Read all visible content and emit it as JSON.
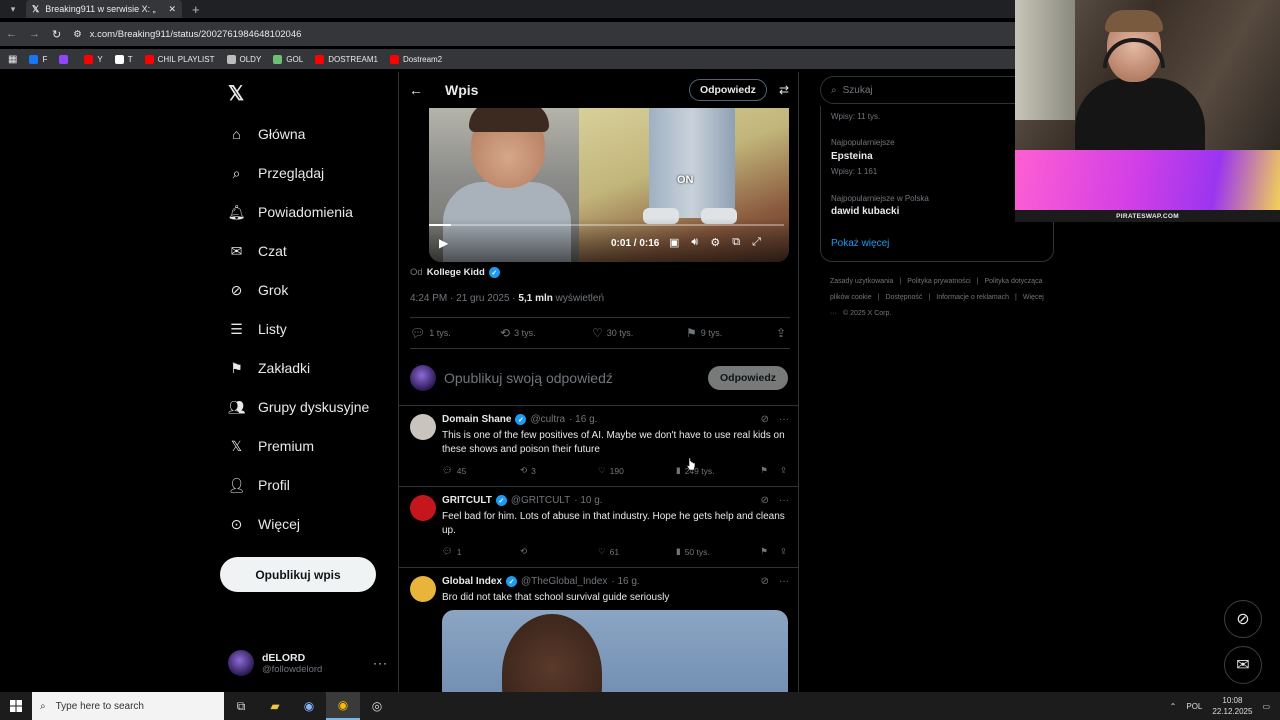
{
  "browser": {
    "tab_title": "Breaking911 w serwisie X: „",
    "url_host": "x.com",
    "url_path": "/Breaking911/status/2002761984648102046",
    "bookmarks": [
      {
        "label": "F",
        "color": "#1877f2"
      },
      {
        "label": "",
        "color": "#9146ff"
      },
      {
        "label": "Y",
        "color": "#ff0000"
      },
      {
        "label": "T",
        "color": "#ffffff"
      },
      {
        "label": "CHIL PLAYLIST",
        "color": "#ff0000"
      },
      {
        "label": "OLDY",
        "color": "#bdbdbd"
      },
      {
        "label": "GOL",
        "color": "#6fbf73"
      },
      {
        "label": "DOSTREAM1",
        "color": "#ff0000"
      },
      {
        "label": "Dostream2",
        "color": "#ff0000"
      }
    ]
  },
  "nav": {
    "items": [
      {
        "label": "Główna",
        "icon": "home-icon"
      },
      {
        "label": "Przeglądaj",
        "icon": "search-icon"
      },
      {
        "label": "Powiadomienia",
        "icon": "bell-icon"
      },
      {
        "label": "Czat",
        "icon": "mail-icon"
      },
      {
        "label": "Grok",
        "icon": "grok-icon"
      },
      {
        "label": "Listy",
        "icon": "list-icon"
      },
      {
        "label": "Zakładki",
        "icon": "bookmark-icon"
      },
      {
        "label": "Grupy dyskusyjne",
        "icon": "people-icon"
      },
      {
        "label": "Premium",
        "icon": "x-icon"
      },
      {
        "label": "Profil",
        "icon": "person-icon"
      },
      {
        "label": "Więcej",
        "icon": "more-circle-icon"
      }
    ],
    "post_button": "Opublikuj wpis",
    "profile": {
      "name": "dELORD",
      "handle": "@followdelord"
    }
  },
  "main": {
    "title": "Wpis",
    "reply_button": "Odpowiedz",
    "video": {
      "time": "0:01 / 0:16",
      "overlay_text": "ON",
      "progress": 0.0625
    },
    "source_prefix": "Od",
    "source_name": "Kollege Kidd",
    "timestamp": "4:24 PM · 21 gru 2025 ·",
    "views_num": "5,1 mln",
    "views_label": "wyświetleń",
    "stats": {
      "replies": "1 tys.",
      "reposts": "3 tys.",
      "likes": "30 tys.",
      "bookmarks": "9 tys."
    },
    "compose": {
      "placeholder": "Opublikuj swoją odpowiedź",
      "button": "Odpowiedz"
    },
    "replies": [
      {
        "name": "Domain Shane",
        "handle": "@cultra",
        "time": "· 16 g.",
        "text": "This is one of the few positives of AI. Maybe we don't have to use real kids on these shows and poison their future",
        "replies": "45",
        "reposts": "3",
        "likes": "190",
        "views": "249 tys.",
        "avatar_color": "#c9c4bd"
      },
      {
        "name": "GRITCULT",
        "handle": "@GRITCULT",
        "time": "· 10 g.",
        "text": "Feel bad for him. Lots of abuse in that industry. Hope he gets help and cleans up.",
        "replies": "1",
        "reposts": "",
        "likes": "61",
        "views": "50 tys.",
        "avatar_color": "#c4161c"
      },
      {
        "name": "Global Index",
        "handle": "@TheGlobal_Index",
        "time": "· 16 g.",
        "text": "Bro did not take that school survival guide seriously",
        "avatar_color": "#e8b53a"
      }
    ]
  },
  "sidebar": {
    "search_placeholder": "Szukaj",
    "trends": [
      {
        "context": "Wpisy: 11 tys."
      },
      {
        "context": "Najpopularniejsze",
        "title": "Epsteina",
        "count": "Wpisy: 1 161"
      },
      {
        "context": "Najpopularniejsze w Polska",
        "title": "dawid kubacki"
      }
    ],
    "show_more": "Pokaż więcej",
    "footer": [
      "Zasady użytkowania",
      "|",
      "Polityka prywatności",
      "|",
      "Polityka dotycząca plików cookie",
      "|",
      "Dostępność",
      "|",
      "Informacje o reklamach",
      "|",
      "Więcej ···",
      "© 2025 X Corp."
    ]
  },
  "overlay": {
    "banner_text": "PIRATESWAP.COM"
  },
  "taskbar": {
    "search_placeholder": "Type here to search",
    "language": "POL",
    "time": "10:08",
    "date": "22.12.2025"
  }
}
